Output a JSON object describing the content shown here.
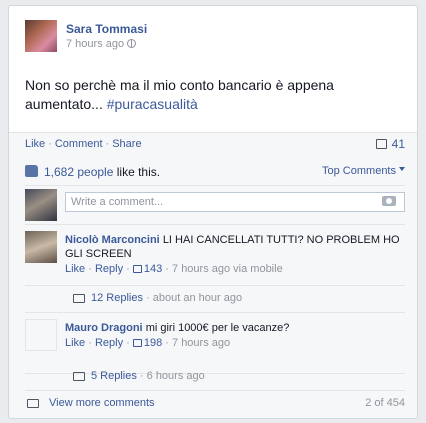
{
  "post": {
    "author": "Sara Tommasi",
    "time": "7 hours ago",
    "text": "Non so perchè ma il mio conto bancario è appena aumentato...",
    "hashtag": "#puracasualità"
  },
  "actions": {
    "like": "Like",
    "comment": "Comment",
    "share": "Share",
    "comments_count": "41"
  },
  "likes": {
    "count_text": "1,682 people",
    "suffix": " like this.",
    "top_comments": "Top Comments"
  },
  "composer": {
    "placeholder": "Write a comment..."
  },
  "comments": [
    {
      "author": "Nicolò Marconcini",
      "text": "LI HAI CANCELLATI TUTTI? NO PROBLEM HO GLI SCREEN",
      "like": "Like",
      "reply": "Reply",
      "likes": "143",
      "time": "7 hours ago via mobile",
      "replies": "12 Replies",
      "replies_time": "about an hour ago"
    },
    {
      "author": "Mauro Dragoni",
      "text": "mi giri 1000€ per le vacanze?",
      "like": "Like",
      "reply": "Reply",
      "likes": "198",
      "time": "7 hours ago",
      "replies": "5 Replies",
      "replies_time": "6 hours ago"
    }
  ],
  "footer": {
    "view_more": "View more comments",
    "pager": "2 of 454"
  },
  "colors": {
    "link": "#3b5998",
    "muted": "#90949c",
    "bg": "#f6f7f9"
  }
}
